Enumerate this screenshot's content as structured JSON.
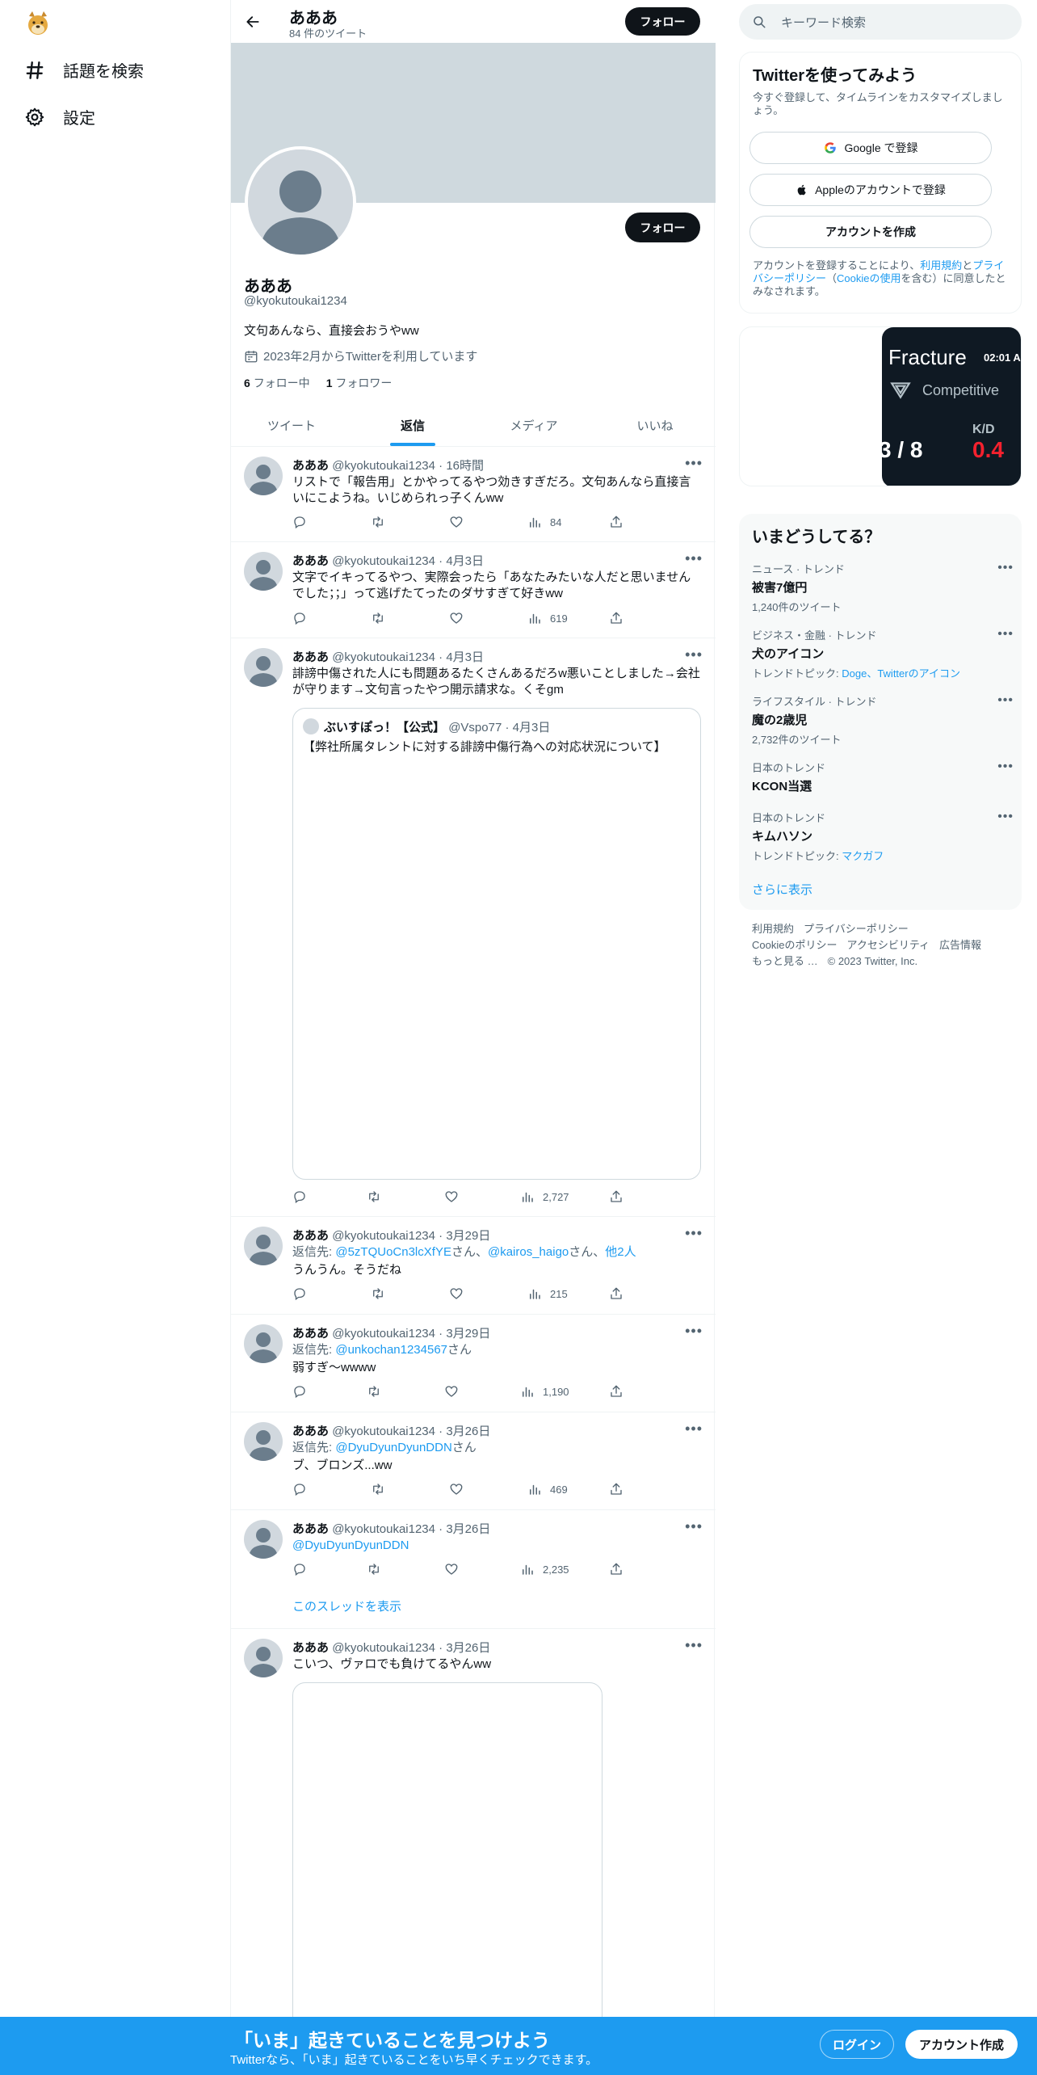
{
  "nav": {
    "explore": "話題を検索",
    "settings": "設定"
  },
  "header": {
    "name": "あああ",
    "tweet_count": "84 件のツイート",
    "follow_label": "フォロー"
  },
  "profile": {
    "name": "あああ",
    "handle": "@kyokutoukai1234",
    "bio": "文句あんなら、直接会おうやww",
    "joined": "2023年2月からTwitterを利用しています",
    "following_count": "6",
    "following_label": "フォロー中",
    "followers_count": "1",
    "followers_label": "フォロワー",
    "follow_label": "フォロー"
  },
  "tabs": [
    "ツイート",
    "返信",
    "メディア",
    "いいね"
  ],
  "tweets": [
    {
      "name": "あああ",
      "handle": "@kyokutoukai1234",
      "time": "16時間",
      "lines": [
        "リストで「報告用」とかやってるやつ効きすぎだろ。文句あんなら直接言",
        "いにこようね。いじめられっ子くんww"
      ],
      "views": "84"
    },
    {
      "name": "あああ",
      "handle": "@kyokutoukai1234",
      "time": "4月3日",
      "lines": [
        "文字でイキってるやつ、実際会ったら「あなたみたいな人だと思いません",
        "でした；；」って逃げたてったのダサすぎて好きww"
      ],
      "views": "619"
    },
    {
      "name": "あああ",
      "handle": "@kyokutoukai1234",
      "time": "4月3日",
      "lines": [
        "誹謗中傷された人にも問題あるたくさんあるだろw悪いことしました→会社",
        "が守ります→文句言ったやつ開示請求な。くそgm"
      ],
      "views": "2,727",
      "quote": {
        "name": "ぶいすぽっ！【公式】",
        "handle": "@Vspo77",
        "time": "4月3日",
        "text": "【弊社所属タレントに対する誹謗中傷行為への対応状況について】"
      }
    },
    {
      "name": "あああ",
      "handle": "@kyokutoukai1234",
      "time": "3月29日",
      "reply_prefix": "返信先: ",
      "reply_to_1": "@5zTQUoCn3lcXfYE",
      "san": "さん、",
      "reply_to_2": "@kairos_haigo",
      "san2": "さん、",
      "others": "他2人",
      "text": "うんうん。そうだね",
      "views": "215"
    },
    {
      "name": "あああ",
      "handle": "@kyokutoukai1234",
      "time": "3月29日",
      "reply_prefix": "返信先: ",
      "reply_to_1": "@unkochan1234567",
      "san": "さん",
      "text": "弱すぎ〜wwww",
      "views": "1,190"
    },
    {
      "name": "あああ",
      "handle": "@kyokutoukai1234",
      "time": "3月26日",
      "reply_prefix": "返信先: ",
      "reply_to_1": "@DyuDyunDyunDDN",
      "san": "さん",
      "text": "ブ、ブロンズ...ww",
      "views": "469"
    },
    {
      "name": "あああ",
      "handle": "@kyokutoukai1234",
      "time": "3月26日",
      "mention": "@DyuDyunDyunDDN",
      "views": "2,235",
      "thread_link": "このスレッドを表示"
    },
    {
      "name": "あああ",
      "handle": "@kyokutoukai1234",
      "time": "3月26日",
      "text": "こいつ、ヴァロでも負けてるやんww"
    }
  ],
  "search": {
    "placeholder": "キーワード検索"
  },
  "signup": {
    "title": "Twitterを使ってみよう",
    "subtitle": "今すぐ登録して、タイムラインをカスタマイズしましょう。",
    "google": "Google で登録",
    "apple": "Appleのアカウントで登録",
    "create": "アカウントを作成",
    "note_1": "アカウントを登録することにより、",
    "note_terms": "利用規約",
    "note_2": "と",
    "note_privacy": "プライバシーポリシー",
    "note_3": "（",
    "note_cookie": "Cookieの使用",
    "note_4": "を含む）に同意したとみなされます。"
  },
  "promo": {
    "map": "Fracture",
    "time": "02:01 A",
    "mode": "Competitive",
    "score": "3 / 8",
    "kd_label": "K/D",
    "kd_value": "0.4"
  },
  "trends": {
    "title": "いまどうしてる？",
    "items": [
      {
        "category": "ニュース · トレンド",
        "name": "被害7億円",
        "meta": "1,240件のツイート"
      },
      {
        "category": "ビジネス・金融 · トレンド",
        "name": "犬のアイコン",
        "meta_prefix": "トレンドトピック: ",
        "meta_links": "Doge、Twitterのアイコン"
      },
      {
        "category": "ライフスタイル · トレンド",
        "name": "魔の2歳児",
        "meta": "2,732件のツイート"
      },
      {
        "category": "日本のトレンド",
        "name": "KCON当選"
      },
      {
        "category": "日本のトレンド",
        "name": "キムハソン",
        "meta_prefix": "トレンドトピック: ",
        "meta_links": "マクガフ"
      }
    ],
    "show_more": "さらに表示"
  },
  "footer": {
    "terms": "利用規約",
    "privacy": "プライバシーポリシー",
    "cookie": "Cookieのポリシー",
    "accessibility": "アクセシビリティ",
    "ads": "広告情報",
    "more": "もっと見る …",
    "copyright": "© 2023 Twitter, Inc."
  },
  "bottombar": {
    "title": "「いま」起きていることを見つけよう",
    "subtitle": "Twitterなら、「いま」起きていることをいち早くチェックできます。",
    "login": "ログイン",
    "signup": "アカウント作成"
  },
  "colors": {
    "accent": "#1d9bf0",
    "dark": "#0f1419",
    "banner": "#cfd9de",
    "kd": "#f4212e"
  }
}
